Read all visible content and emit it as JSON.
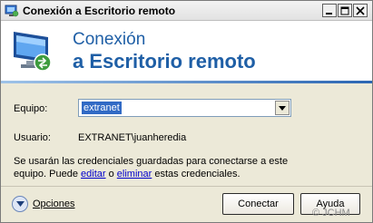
{
  "window": {
    "title": "Conexión a Escritorio remoto"
  },
  "banner": {
    "line1": "Conexión",
    "line2": "a Escritorio remoto",
    "icon": "remote-desktop-computer-icon"
  },
  "form": {
    "computer_label": "Equipo:",
    "computer_value": "extranet",
    "user_label": "Usuario:",
    "user_value": "EXTRANET\\juanheredia"
  },
  "credentials": {
    "text_part1": "Se usarán las credenciales guardadas para conectarse a este equipo.  Puede ",
    "edit_link": "editar",
    "text_part2": " o ",
    "delete_link": "eliminar",
    "text_part3": " estas credenciales."
  },
  "footer": {
    "options_label": "Opciones",
    "connect_label": "Conectar",
    "help_label": "Ayuda"
  },
  "watermark": "© JCHM",
  "colors": {
    "banner_text": "#1f5fa6",
    "selection": "#316ac5",
    "link": "#0000cc",
    "window_bg": "#ece9d8"
  }
}
